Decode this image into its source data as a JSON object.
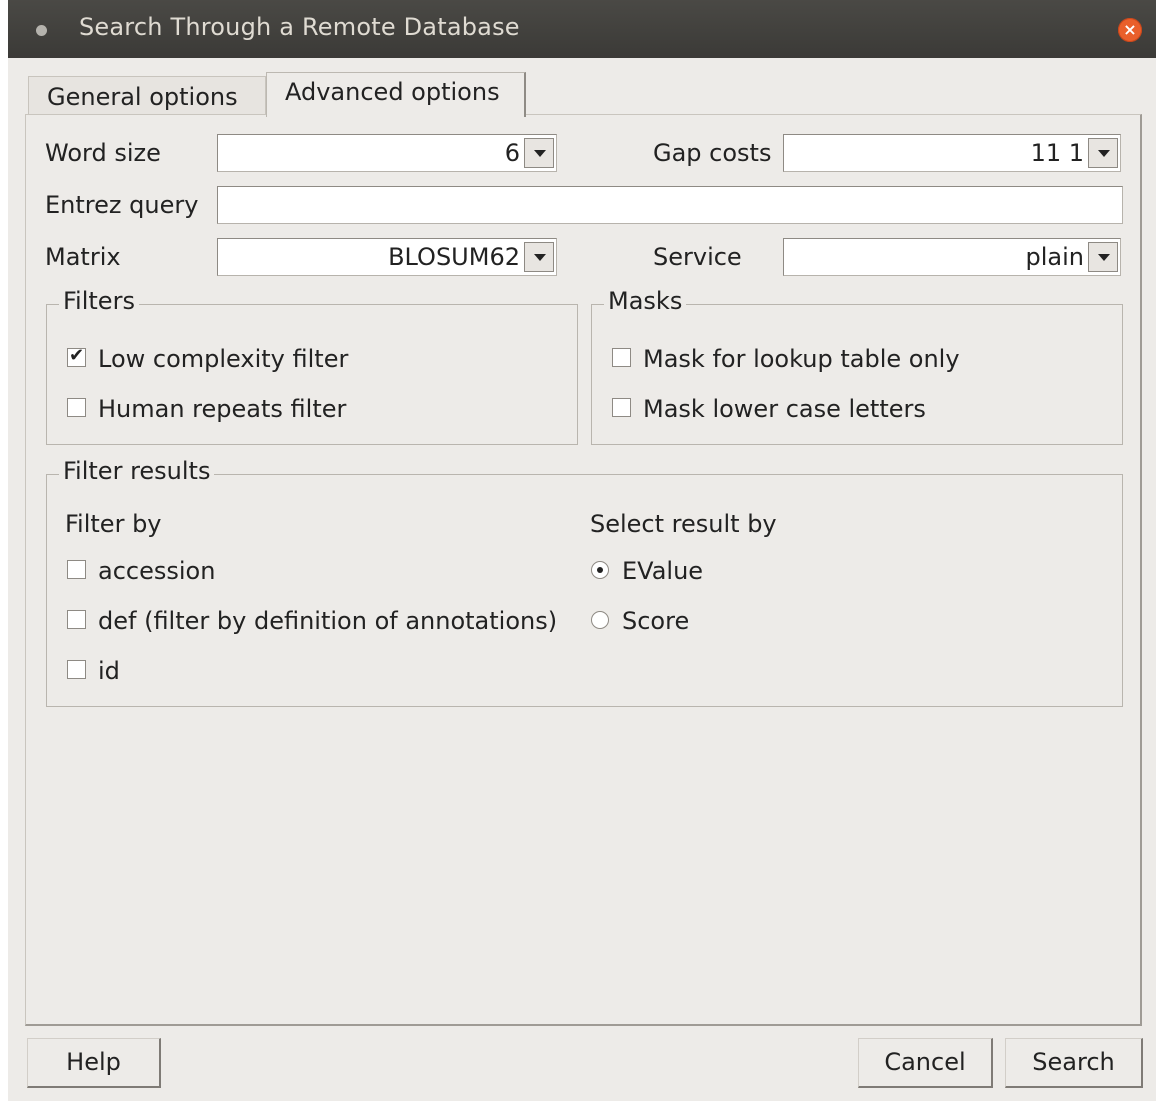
{
  "window": {
    "title": "Search Through a Remote Database",
    "close_symbol": "×"
  },
  "tabs": [
    {
      "label": "General options",
      "active": false
    },
    {
      "label": "Advanced options",
      "active": true
    }
  ],
  "fields": {
    "word_size_label": "Word size",
    "word_size_value": "6",
    "gap_costs_label": "Gap costs",
    "gap_costs_value": "11 1",
    "entrez_query_label": "Entrez query",
    "entrez_query_value": "",
    "matrix_label": "Matrix",
    "matrix_value": "BLOSUM62",
    "service_label": "Service",
    "service_value": "plain"
  },
  "filters": {
    "title": "Filters",
    "items": [
      {
        "label": "Low complexity filter",
        "checked": true
      },
      {
        "label": "Human repeats filter",
        "checked": false
      }
    ]
  },
  "masks": {
    "title": "Masks",
    "items": [
      {
        "label": "Mask for lookup table only",
        "checked": false
      },
      {
        "label": "Mask lower case letters",
        "checked": false
      }
    ]
  },
  "filter_results": {
    "title": "Filter results",
    "filter_by_label": "Filter by",
    "filter_by_items": [
      {
        "label": "accession",
        "checked": false
      },
      {
        "label": "def (filter by definition of annotations)",
        "checked": false
      },
      {
        "label": "id",
        "checked": false
      }
    ],
    "select_by_label": "Select result by",
    "select_by_items": [
      {
        "label": "EValue",
        "selected": true
      },
      {
        "label": "Score",
        "selected": false
      }
    ]
  },
  "buttons": {
    "help": "Help",
    "cancel": "Cancel",
    "search": "Search"
  },
  "colors": {
    "titlebar": "#3b3a37",
    "close_button": "#e95f2b",
    "dialog_bg": "#edebe8"
  }
}
